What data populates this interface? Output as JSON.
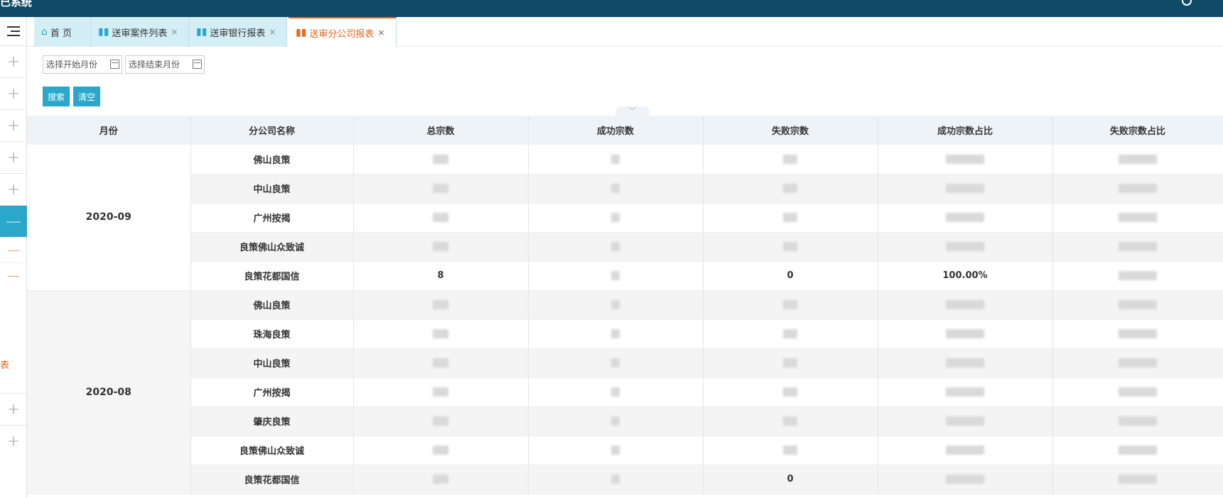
{
  "app": {
    "brand": "已系统"
  },
  "tabs": [
    {
      "label": "首 页",
      "icon": "home-icon",
      "closable": false,
      "active": false
    },
    {
      "label": "送审案件列表",
      "icon": "bar-chart-icon",
      "closable": true,
      "active": false
    },
    {
      "label": "送审银行报表",
      "icon": "bar-chart-icon",
      "closable": true,
      "active": false
    },
    {
      "label": "送审分公司报表",
      "icon": "bar-chart-icon",
      "closable": true,
      "active": true
    }
  ],
  "rail": {
    "partial_label": "表"
  },
  "filter": {
    "start_placeholder": "选择开始月份",
    "end_placeholder": "选择结束月份",
    "search_label": "搜索",
    "clear_label": "清空"
  },
  "table": {
    "columns": [
      "月份",
      "分公司名称",
      "总宗数",
      "成功宗数",
      "失败宗数",
      "成功宗数占比",
      "失败宗数占比"
    ],
    "groups": [
      {
        "month": "2020-09",
        "rows": [
          {
            "branch": "佛山良策",
            "total": "",
            "success": "",
            "fail": "",
            "success_rate": "",
            "fail_rate": ""
          },
          {
            "branch": "中山良策",
            "total": "",
            "success": "",
            "fail": "",
            "success_rate": "",
            "fail_rate": ""
          },
          {
            "branch": "广州按揭",
            "total": "",
            "success": "",
            "fail": "",
            "success_rate": "",
            "fail_rate": ""
          },
          {
            "branch": "良策佛山众致诚",
            "total": "",
            "success": "",
            "fail": "",
            "success_rate": "",
            "fail_rate": ""
          },
          {
            "branch": "良策花都国信",
            "total": "8",
            "success": "",
            "fail": "0",
            "success_rate": "100.00%",
            "fail_rate": ""
          }
        ]
      },
      {
        "month": "2020-08",
        "rows": [
          {
            "branch": "佛山良策",
            "total": "",
            "success": "",
            "fail": "",
            "success_rate": "",
            "fail_rate": ""
          },
          {
            "branch": "珠海良策",
            "total": "",
            "success": "",
            "fail": "",
            "success_rate": "",
            "fail_rate": ""
          },
          {
            "branch": "中山良策",
            "total": "",
            "success": "",
            "fail": "",
            "success_rate": "",
            "fail_rate": ""
          },
          {
            "branch": "广州按揭",
            "total": "",
            "success": "",
            "fail": "",
            "success_rate": "",
            "fail_rate": ""
          },
          {
            "branch": "肇庆良策",
            "total": "",
            "success": "",
            "fail": "",
            "success_rate": "",
            "fail_rate": ""
          },
          {
            "branch": "良策佛山众致诚",
            "total": "",
            "success": "",
            "fail": "",
            "success_rate": "",
            "fail_rate": ""
          },
          {
            "branch": "良策花都国信",
            "total": "",
            "success": "",
            "fail": "0",
            "success_rate": "",
            "fail_rate": ""
          }
        ]
      }
    ]
  }
}
